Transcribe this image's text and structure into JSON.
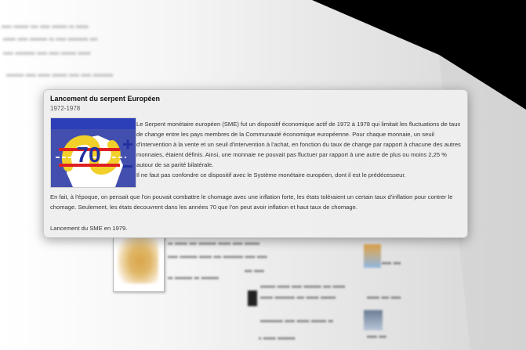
{
  "popup": {
    "title": "Lancement du serpent Européen",
    "years": "1972-1978",
    "paragraph1": "Le Serpent monétaire européen (SME) fut un dispositif économique actif de 1972 à 1978 qui limitait les fluctuations de taux de change entre les pays membres de la Communauté économique européenne. Pour chaque monnaie, un seuil d'intervention à la vente et un seuil d'intervention à l'achat, en fonction du taux de change par rapport à chacune des autres monnaies, étaient définis. Ainsi, une monnaie ne pouvait pas fluctuer par rapport à une autre de plus ou moins 2,25 % autour de sa parité bilatérale.",
    "paragraph2": "Il ne faut pas confondre ce dispositif avec le Système monétaire européen, dont il est le prédécesseur.",
    "paragraph3": "En fait, à l'époque, on pensait que l'on pouvait combattre le chomage avec une inflation forte, les états toléraient un certain taux d'inflation pour contrer le chomage. Seulement, les états decouvrent dans les années 70 que l'on peut avoir inflation et haut taux de chomage.",
    "paragraph4": "Lancement du SME en 1979.",
    "logo_text": "70",
    "logo_icon": "serpent-logo"
  },
  "colors": {
    "logo_blue": "#2230a0",
    "logo_red": "#e02020",
    "logo_yellow": "#f2d02a"
  }
}
